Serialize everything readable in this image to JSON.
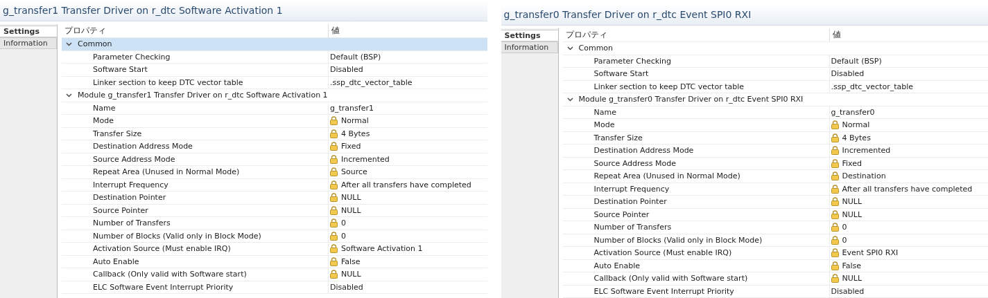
{
  "panels": [
    {
      "title": "g_transfer1 Transfer Driver on r_dtc Software Activation 1",
      "tabs": [
        {
          "label": "Settings",
          "selected": true
        },
        {
          "label": "Information",
          "selected": false
        }
      ],
      "columns": [
        "プロパティ",
        "値"
      ],
      "groups": [
        {
          "label": "Common",
          "expanded": true,
          "selected": true,
          "properties": [
            {
              "name": "Parameter Checking",
              "value": "Default (BSP)",
              "locked": false
            },
            {
              "name": "Software Start",
              "value": "Disabled",
              "locked": false
            },
            {
              "name": "Linker section to keep DTC vector table",
              "value": ".ssp_dtc_vector_table",
              "locked": false
            }
          ]
        },
        {
          "label": "Module g_transfer1 Transfer Driver on r_dtc Software Activation 1",
          "expanded": true,
          "selected": false,
          "properties": [
            {
              "name": "Name",
              "value": "g_transfer1",
              "locked": false
            },
            {
              "name": "Mode",
              "value": "Normal",
              "locked": true
            },
            {
              "name": "Transfer Size",
              "value": "4 Bytes",
              "locked": true
            },
            {
              "name": "Destination Address Mode",
              "value": "Fixed",
              "locked": true
            },
            {
              "name": "Source Address Mode",
              "value": "Incremented",
              "locked": true
            },
            {
              "name": "Repeat Area (Unused in Normal Mode)",
              "value": "Source",
              "locked": true
            },
            {
              "name": "Interrupt Frequency",
              "value": "After all transfers have completed",
              "locked": true
            },
            {
              "name": "Destination Pointer",
              "value": "NULL",
              "locked": true
            },
            {
              "name": "Source Pointer",
              "value": "NULL",
              "locked": true
            },
            {
              "name": "Number of Transfers",
              "value": "0",
              "locked": true
            },
            {
              "name": "Number of Blocks (Valid only in Block Mode)",
              "value": "0",
              "locked": true
            },
            {
              "name": "Activation Source (Must enable IRQ)",
              "value": "Software Activation 1",
              "locked": true
            },
            {
              "name": "Auto Enable",
              "value": "False",
              "locked": true
            },
            {
              "name": "Callback (Only valid with Software start)",
              "value": "NULL",
              "locked": true
            },
            {
              "name": "ELC Software Event Interrupt Priority",
              "value": "Disabled",
              "locked": false
            }
          ]
        }
      ]
    },
    {
      "title": "g_transfer0 Transfer Driver on r_dtc Event SPI0 RXI",
      "tabs": [
        {
          "label": "Settings",
          "selected": true
        },
        {
          "label": "Information",
          "selected": false
        }
      ],
      "columns": [
        "プロパティ",
        "値"
      ],
      "groups": [
        {
          "label": "Common",
          "expanded": true,
          "selected": false,
          "properties": [
            {
              "name": "Parameter Checking",
              "value": "Default (BSP)",
              "locked": false
            },
            {
              "name": "Software Start",
              "value": "Disabled",
              "locked": false
            },
            {
              "name": "Linker section to keep DTC vector table",
              "value": ".ssp_dtc_vector_table",
              "locked": false
            }
          ]
        },
        {
          "label": "Module g_transfer0 Transfer Driver on r_dtc Event SPI0 RXI",
          "expanded": true,
          "selected": false,
          "properties": [
            {
              "name": "Name",
              "value": "g_transfer0",
              "locked": false
            },
            {
              "name": "Mode",
              "value": "Normal",
              "locked": true
            },
            {
              "name": "Transfer Size",
              "value": "4 Bytes",
              "locked": true
            },
            {
              "name": "Destination Address Mode",
              "value": "Incremented",
              "locked": true
            },
            {
              "name": "Source Address Mode",
              "value": "Fixed",
              "locked": true
            },
            {
              "name": "Repeat Area (Unused in Normal Mode)",
              "value": "Destination",
              "locked": true
            },
            {
              "name": "Interrupt Frequency",
              "value": "After all transfers have completed",
              "locked": true
            },
            {
              "name": "Destination Pointer",
              "value": "NULL",
              "locked": true
            },
            {
              "name": "Source Pointer",
              "value": "NULL",
              "locked": true
            },
            {
              "name": "Number of Transfers",
              "value": "0",
              "locked": true
            },
            {
              "name": "Number of Blocks (Valid only in Block Mode)",
              "value": "0",
              "locked": true
            },
            {
              "name": "Activation Source (Must enable IRQ)",
              "value": "Event SPI0 RXI",
              "locked": true
            },
            {
              "name": "Auto Enable",
              "value": "False",
              "locked": true
            },
            {
              "name": "Callback (Only valid with Software start)",
              "value": "NULL",
              "locked": true
            },
            {
              "name": "ELC Software Event Interrupt Priority",
              "value": "Disabled",
              "locked": false
            }
          ]
        }
      ]
    }
  ]
}
